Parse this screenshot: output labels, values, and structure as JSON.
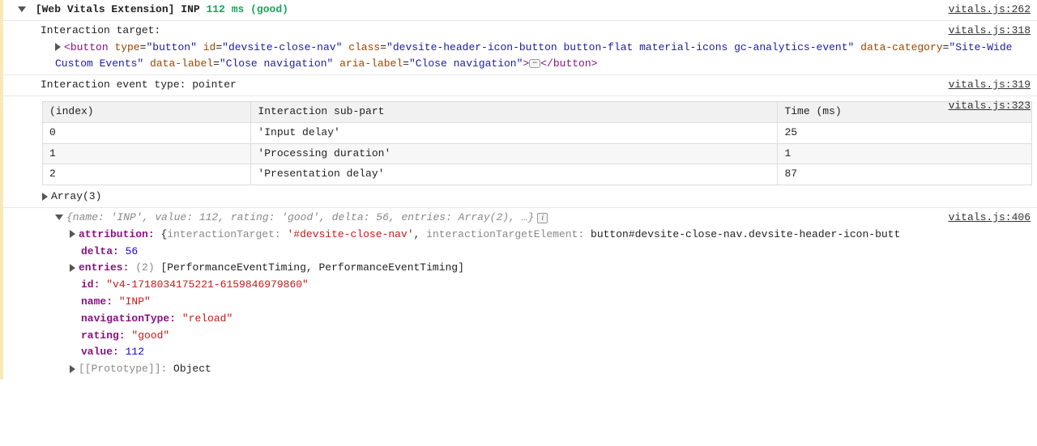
{
  "rows": {
    "header": {
      "prefix": "[Web Vitals Extension]",
      "metric": "INP",
      "value": "112 ms",
      "rating": "(good)",
      "source": "vitals.js:262"
    },
    "target": {
      "label": "Interaction target:",
      "source": "vitals.js:318",
      "el": {
        "tag": "button",
        "attrs": {
          "type": "button",
          "id": "devsite-close-nav",
          "class": "devsite-header-icon-button button-flat material-icons gc-analytics-event",
          "dataCategory": "Site-Wide Custom Events",
          "dataLabel": "Close navigation",
          "ariaLabel": "Close navigation"
        }
      }
    },
    "event": {
      "text": "Interaction event type: pointer",
      "source": "vitals.js:319"
    },
    "table": {
      "source": "vitals.js:323",
      "headers": {
        "c0": "(index)",
        "c1": "Interaction sub-part",
        "c2": "Time (ms)"
      },
      "rows": [
        {
          "i": "0",
          "part": "'Input delay'",
          "ms": "25"
        },
        {
          "i": "1",
          "part": "'Processing duration'",
          "ms": "1"
        },
        {
          "i": "2",
          "part": "'Presentation delay'",
          "ms": "87"
        }
      ],
      "arrayLabel": "Array(3)"
    },
    "obj": {
      "source": "vitals.js:406",
      "summary": "{name: 'INP', value: 112, rating: 'good', delta: 56, entries: Array(2), …}",
      "attribution": {
        "key": "attribution:",
        "interactionTargetKey": "interactionTarget:",
        "interactionTargetVal": "'#devsite-close-nav'",
        "targetElKey": "interactionTargetElement:",
        "targetElVal": "button#devsite-close-nav.devsite-header-icon-butt"
      },
      "delta": {
        "key": "delta:",
        "val": "56"
      },
      "entries": {
        "key": "entries:",
        "count": "(2)",
        "val": "[PerformanceEventTiming, PerformanceEventTiming]"
      },
      "id": {
        "key": "id:",
        "val": "\"v4-1718034175221-6159846979860\""
      },
      "name": {
        "key": "name:",
        "val": "\"INP\""
      },
      "navType": {
        "key": "navigationType:",
        "val": "\"reload\""
      },
      "rating": {
        "key": "rating:",
        "val": "\"good\""
      },
      "value": {
        "key": "value:",
        "val": "112"
      },
      "proto": {
        "key": "[[Prototype]]:",
        "val": "Object"
      }
    }
  }
}
